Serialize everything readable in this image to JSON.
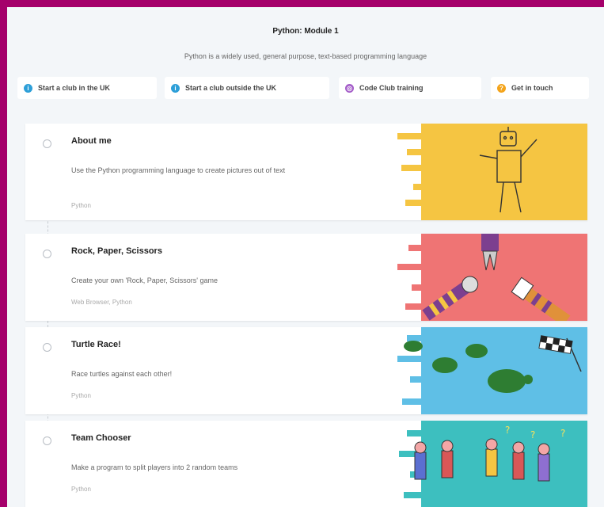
{
  "header": {
    "title": "Python: Module 1",
    "subtitle": "Python is a widely used, general purpose, text-based programming language"
  },
  "tabs": [
    {
      "label": "Start a club in the UK",
      "icon": "info-icon",
      "color": "#2d9fd8"
    },
    {
      "label": "Start a club outside the UK",
      "icon": "info-icon",
      "color": "#2d9fd8"
    },
    {
      "label": "Code Club training",
      "icon": "training-icon",
      "color": "#a35bc8"
    },
    {
      "label": "Get in touch",
      "icon": "question-icon",
      "color": "#f4a41b"
    }
  ],
  "projects": [
    {
      "title": "About me",
      "description": "Use the Python programming language to create pictures out of text",
      "tags": "Python",
      "art_color": "#f5c542",
      "art": "robot-illustration"
    },
    {
      "title": "Rock, Paper, Scissors",
      "description": "Create your own 'Rock, Paper, Scissors' game",
      "tags": "Web Browser, Python",
      "art_color": "#ef7474",
      "art": "rock-paper-scissors-illustration"
    },
    {
      "title": "Turtle Race!",
      "description": "Race turtles against each other!",
      "tags": "Python",
      "art_color": "#5fbfe6",
      "art": "turtle-race-illustration"
    },
    {
      "title": "Team Chooser",
      "description": "Make a program to split players into 2 random teams",
      "tags": "Python",
      "art_color": "#3dbfbf",
      "art": "team-chooser-illustration"
    }
  ]
}
